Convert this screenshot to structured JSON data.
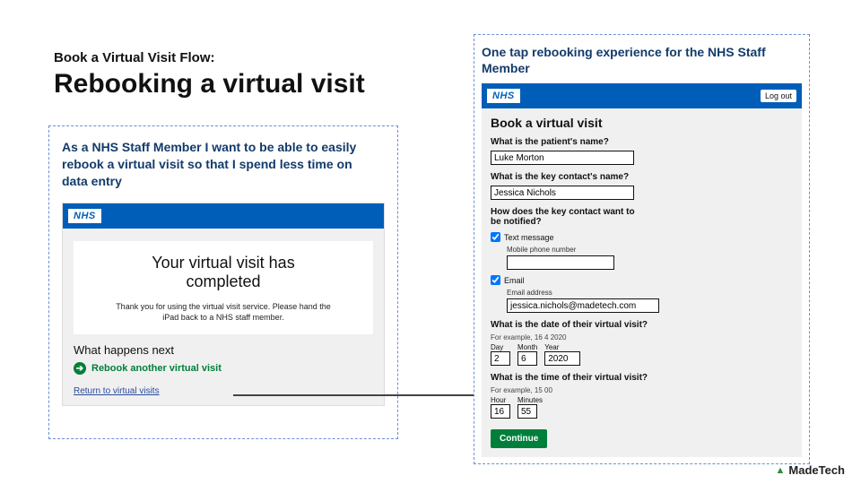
{
  "header": {
    "eyebrow": "Book a Virtual Visit Flow:",
    "title": "Rebooking a virtual visit"
  },
  "left": {
    "story": "As a NHS Staff Member I want to be able to easily rebook a virtual visit so that I spend less time on data entry",
    "nhs": "NHS",
    "card_title_1": "Your virtual visit has",
    "card_title_2": "completed",
    "card_body": "Thank you for using the virtual visit service. Please hand the iPad back to a NHS staff member.",
    "whn": "What happens next",
    "rebook": "Rebook another virtual visit",
    "return": "Return to virtual visits"
  },
  "right": {
    "caption": "One tap rebooking experience for the NHS Staff Member",
    "nhs": "NHS",
    "logout": "Log out",
    "title": "Book a virtual visit",
    "q_patient": "What is the patient's name?",
    "patient": "Luke Morton",
    "q_contact": "What is the key contact's name?",
    "contact": "Jessica Nichols",
    "q_notify": "How does the key contact want to be notified?",
    "cb_text": "Text message",
    "sub_phone": "Mobile phone number",
    "phone": "",
    "cb_email": "Email",
    "sub_email": "Email address",
    "email": "jessica.nichols@madetech.com",
    "q_date": "What is the date of their virtual visit?",
    "hint_date": "For example, 16 4 2020",
    "day_l": "Day",
    "month_l": "Month",
    "year_l": "Year",
    "day": "2",
    "month": "6",
    "year": "2020",
    "q_time": "What is the time of their virtual visit?",
    "hint_time": "For example, 15 00",
    "hour_l": "Hour",
    "min_l": "Minutes",
    "hour": "16",
    "min": "55",
    "continue": "Continue"
  },
  "brand": "MadeTech"
}
